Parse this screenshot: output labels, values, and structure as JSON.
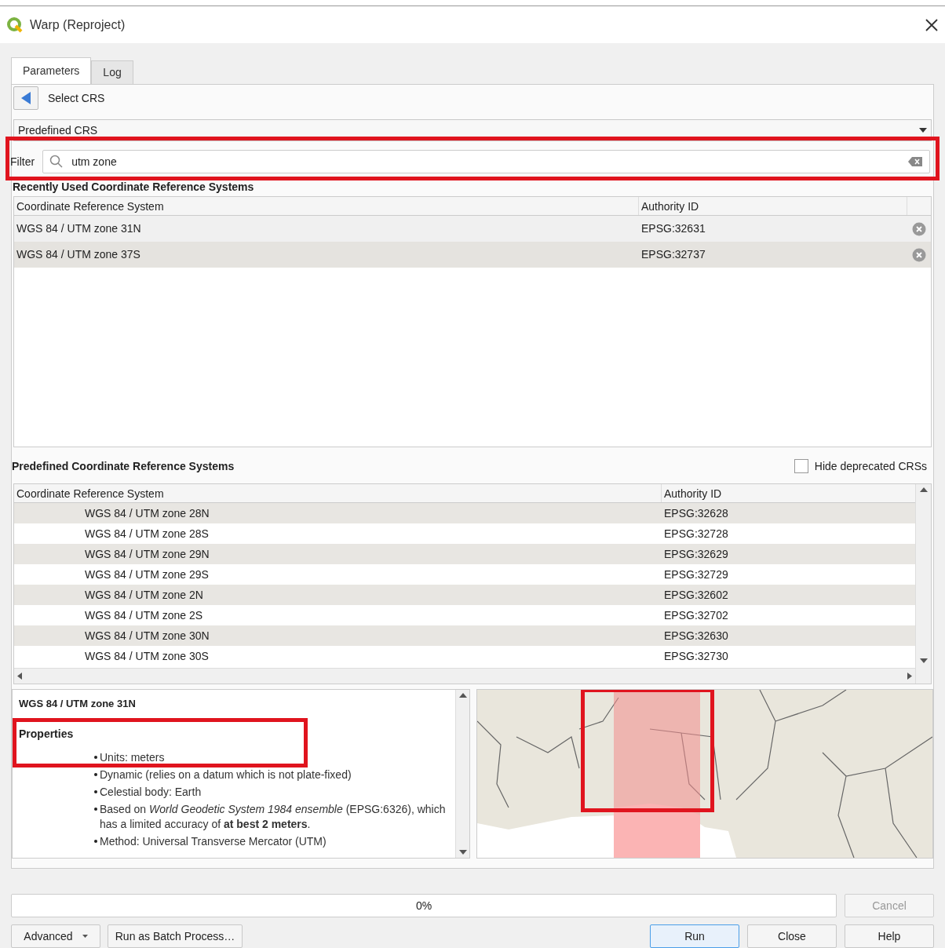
{
  "window": {
    "title": "Warp (Reproject)"
  },
  "tabs": [
    {
      "label": "Parameters",
      "selected": true
    },
    {
      "label": "Log",
      "selected": false
    }
  ],
  "panel_title": "Select CRS",
  "crs_type": {
    "value": "Predefined CRS"
  },
  "filter": {
    "label": "Filter",
    "value": "utm zone",
    "highlighted": true
  },
  "recent": {
    "heading": "Recently Used Coordinate Reference Systems",
    "columns": [
      "Coordinate Reference System",
      "Authority ID"
    ],
    "rows": [
      {
        "name": "WGS 84 / UTM zone 31N",
        "id": "EPSG:32631",
        "selected": false
      },
      {
        "name": "WGS 84 / UTM zone 37S",
        "id": "EPSG:32737",
        "selected": true
      }
    ]
  },
  "predefined": {
    "heading": "Predefined Coordinate Reference Systems",
    "hide_deprecated": {
      "label": "Hide deprecated CRSs",
      "checked": false
    },
    "columns": [
      "Coordinate Reference System",
      "Authority ID"
    ],
    "rows": [
      {
        "name": "WGS 84 / UTM zone 28N",
        "id": "EPSG:32628"
      },
      {
        "name": "WGS 84 / UTM zone 28S",
        "id": "EPSG:32728"
      },
      {
        "name": "WGS 84 / UTM zone 29N",
        "id": "EPSG:32629"
      },
      {
        "name": "WGS 84 / UTM zone 29S",
        "id": "EPSG:32729"
      },
      {
        "name": "WGS 84 / UTM zone 2N",
        "id": "EPSG:32602"
      },
      {
        "name": "WGS 84 / UTM zone 2S",
        "id": "EPSG:32702"
      },
      {
        "name": "WGS 84 / UTM zone 30N",
        "id": "EPSG:32630"
      },
      {
        "name": "WGS 84 / UTM zone 30S",
        "id": "EPSG:32730"
      }
    ]
  },
  "details": {
    "title": "WGS 84 / UTM zone 31N",
    "section": "Properties",
    "highlighted": true,
    "items": [
      "Units: meters",
      "Dynamic (relies on a datum which is not plate-fixed)",
      "Celestial body: Earth",
      "Based on *World Geodetic System 1984 ensemble* (EPSG:6326), which has a limited accuracy of **at best 2 meters**.",
      "Method: Universal Transverse Mercator (UTM)"
    ]
  },
  "map": {
    "kind": "picture",
    "highlighted": true
  },
  "progress": {
    "reading": "0%"
  },
  "buttons": [
    {
      "label": "Cancel",
      "disabled": true
    },
    {
      "label": "Advanced",
      "kind": "menu",
      "disabled": false
    },
    {
      "label": "Run as Batch Process…",
      "disabled": false
    },
    {
      "label": "Run",
      "default": true,
      "disabled": false
    },
    {
      "label": "Close",
      "disabled": false
    },
    {
      "label": "Help",
      "disabled": false
    }
  ]
}
